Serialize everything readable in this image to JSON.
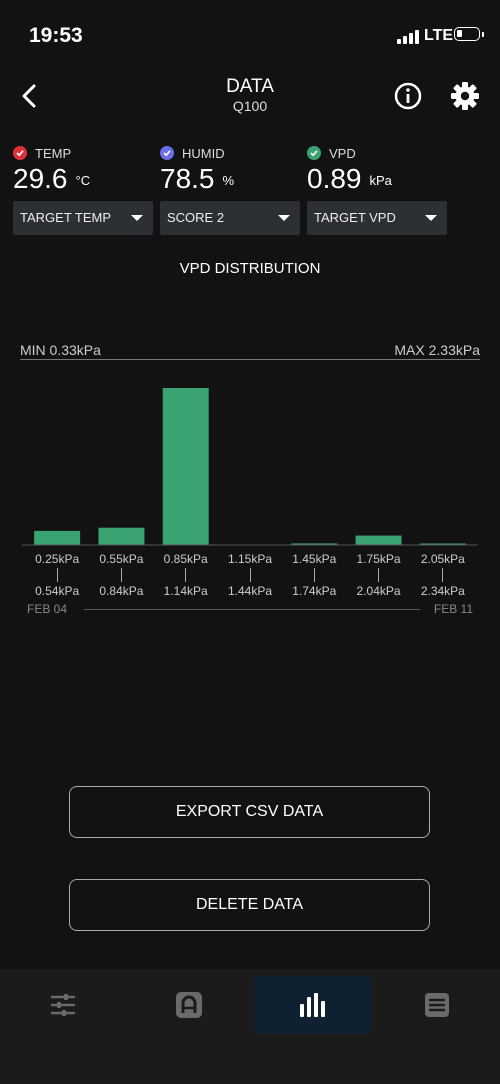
{
  "status_bar": {
    "time": "19:53",
    "network": "LTE"
  },
  "header": {
    "title": "DATA",
    "subtitle": "Q100"
  },
  "metrics": [
    {
      "label": "TEMP",
      "value": "29.6",
      "unit": "°C",
      "color": "#e0303a"
    },
    {
      "label": "HUMID",
      "value": "78.5",
      "unit": "%",
      "color": "#6a6ee8"
    },
    {
      "label": "VPD",
      "value": "0.89",
      "unit": "kPa",
      "color": "#3ba272"
    }
  ],
  "dropdowns": [
    {
      "selected": "TARGET TEMP"
    },
    {
      "selected": "SCORE 2"
    },
    {
      "selected": "TARGET VPD"
    }
  ],
  "chart": {
    "heading": "VPD DISTRIBUTION",
    "min_label": "MIN 0.33kPa",
    "max_label": "MAX 2.33kPa",
    "date_start": "FEB 04",
    "date_end": "FEB 11",
    "bins": [
      {
        "from": "0.25kPa",
        "to": "0.54kPa"
      },
      {
        "from": "0.55kPa",
        "to": "0.84kPa"
      },
      {
        "from": "0.85kPa",
        "to": "1.14kPa"
      },
      {
        "from": "1.15kPa",
        "to": "1.44kPa"
      },
      {
        "from": "1.45kPa",
        "to": "1.74kPa"
      },
      {
        "from": "1.75kPa",
        "to": "2.04kPa"
      },
      {
        "from": "2.05kPa",
        "to": "2.34kPa"
      }
    ]
  },
  "chart_data": {
    "type": "bar",
    "title": "VPD DISTRIBUTION",
    "categories": [
      "0.25kPa – 0.54kPa",
      "0.55kPa – 0.84kPa",
      "0.85kPa – 1.14kPa",
      "1.15kPa – 1.44kPa",
      "1.45kPa – 1.74kPa",
      "1.75kPa – 2.04kPa",
      "2.05kPa – 2.34kPa"
    ],
    "values": [
      9,
      11,
      100,
      0,
      1,
      6,
      0.5
    ],
    "ylim": [
      0,
      100
    ],
    "bar_color": "#3ba272",
    "grid": false
  },
  "actions": {
    "export_label": "EXPORT CSV DATA",
    "delete_label": "DELETE DATA"
  },
  "tabs": [
    {
      "icon": "sliders-icon",
      "active": false
    },
    {
      "icon": "device-icon",
      "active": false
    },
    {
      "icon": "bar-chart-icon",
      "active": true
    },
    {
      "icon": "list-icon",
      "active": false
    }
  ]
}
